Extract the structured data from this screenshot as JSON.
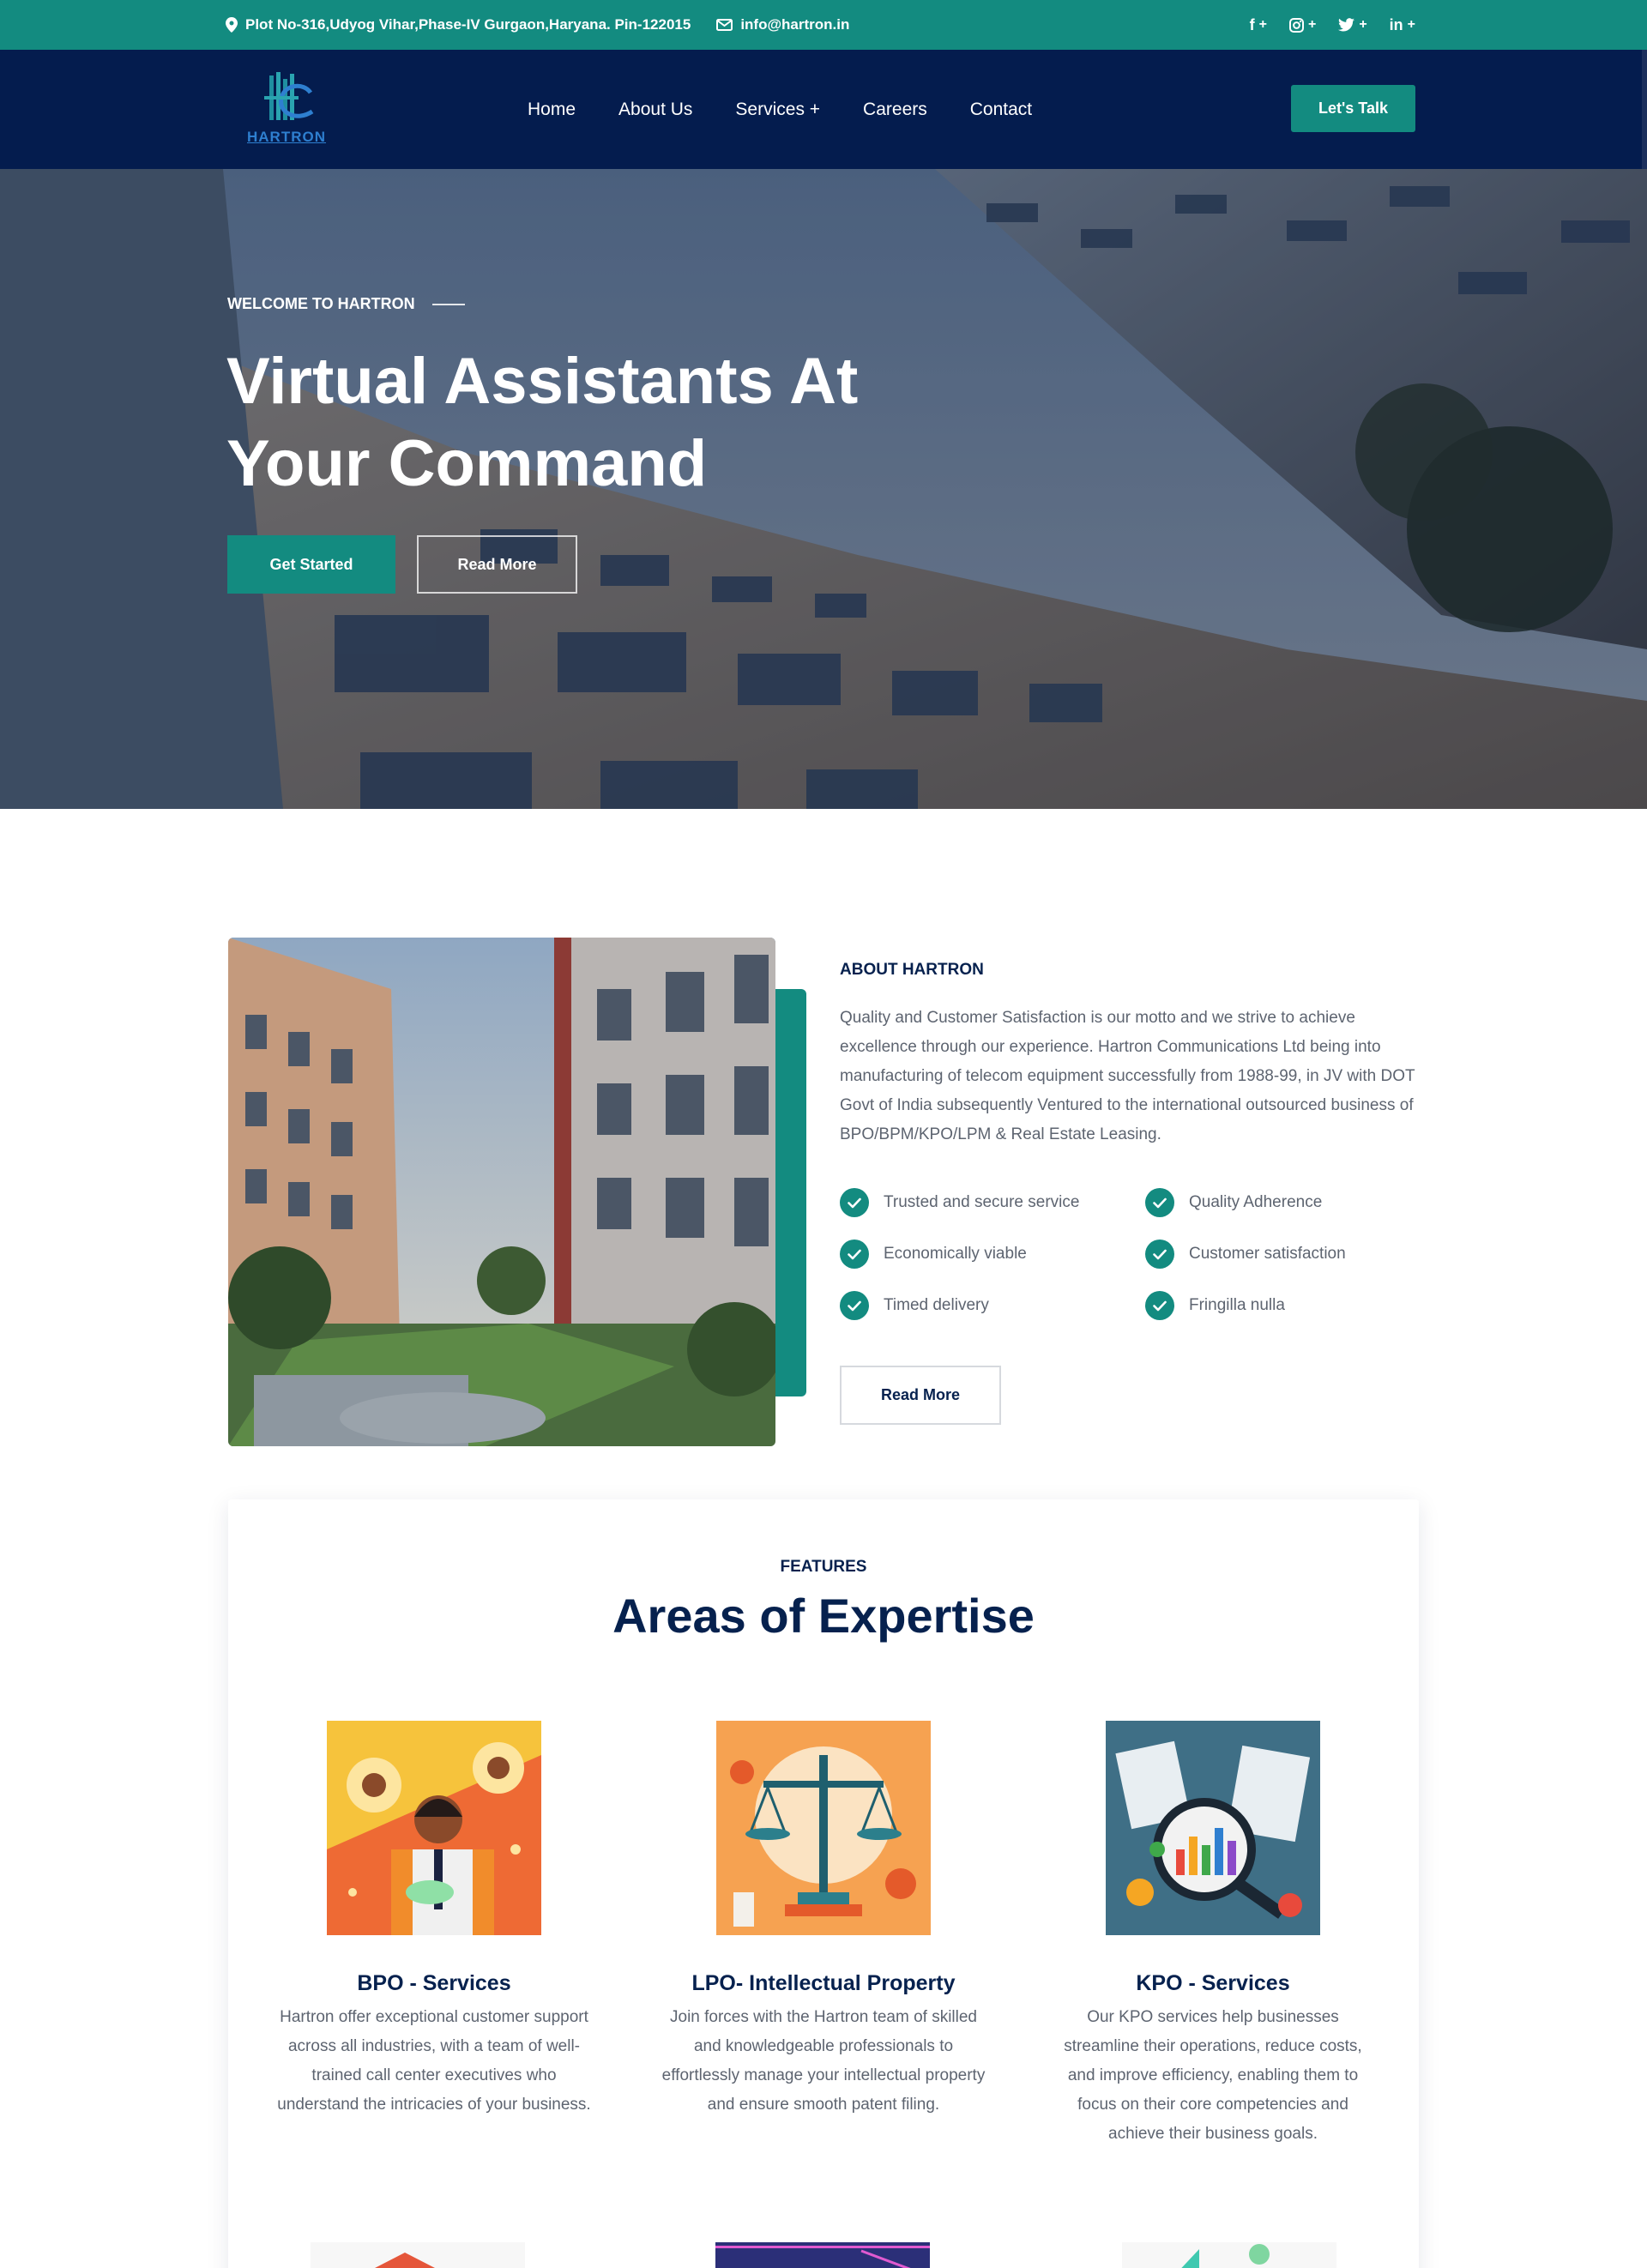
{
  "topbar": {
    "address": "Plot No-316,Udyog Vihar,Phase-IV Gurgaon,Haryana. Pin-122015",
    "email": "info@hartron.in",
    "social": [
      {
        "icon": "facebook-icon",
        "glyph": "f",
        "plus": "+"
      },
      {
        "icon": "instagram-icon",
        "glyph": "◎",
        "plus": "+"
      },
      {
        "icon": "twitter-icon",
        "glyph": "🐦",
        "plus": "+"
      },
      {
        "icon": "linkedin-icon",
        "glyph": "in",
        "plus": "+"
      }
    ]
  },
  "header": {
    "logo_text": "HARTRON",
    "nav": [
      "Home",
      "About Us",
      "Services +",
      "Careers",
      "Contact"
    ],
    "cta": "Let's Talk"
  },
  "hero": {
    "eyebrow": "WELCOME TO HARTRON",
    "title": "Virtual Assistants At Your Command",
    "primary_button": "Get Started",
    "secondary_button": "Read More"
  },
  "about": {
    "label": "ABOUT HARTRON",
    "text": "Quality and Customer Satisfaction is our motto and we strive to achieve excellence through our experience. Hartron Communications Ltd being into manufacturing of telecom equipment successfully from 1988-99, in JV with DOT Govt of India subsequently Ventured to the international outsourced business of BPO/BPM/KPO/LPM & Real Estate Leasing.",
    "checks": [
      "Trusted and secure service",
      "Quality Adherence",
      "Economically viable",
      "Customer satisfaction",
      "Timed delivery",
      "Fringilla nulla"
    ],
    "button": "Read More"
  },
  "features": {
    "eyebrow": "FEATURES",
    "title": "Areas of Expertise",
    "cards": [
      {
        "title": "BPO - Services",
        "text": "Hartron offer exceptional customer support across all industries, with a team of well-trained call center executives who understand the intricacies of your business."
      },
      {
        "title": "LPO- Intellectual Property",
        "text": "Join forces with the Hartron team of skilled and knowledgeable professionals to effortlessly manage your intellectual property and ensure smooth patent filing."
      },
      {
        "title": "KPO - Services",
        "text": "Our KPO services help businesses streamline their operations, reduce costs, and improve efficiency, enabling them to focus on their core competencies and achieve their business goals."
      }
    ]
  },
  "colors": {
    "accent": "#138b80",
    "navy": "#041c4e",
    "heading": "#06214e",
    "body_text": "#5d6470"
  }
}
